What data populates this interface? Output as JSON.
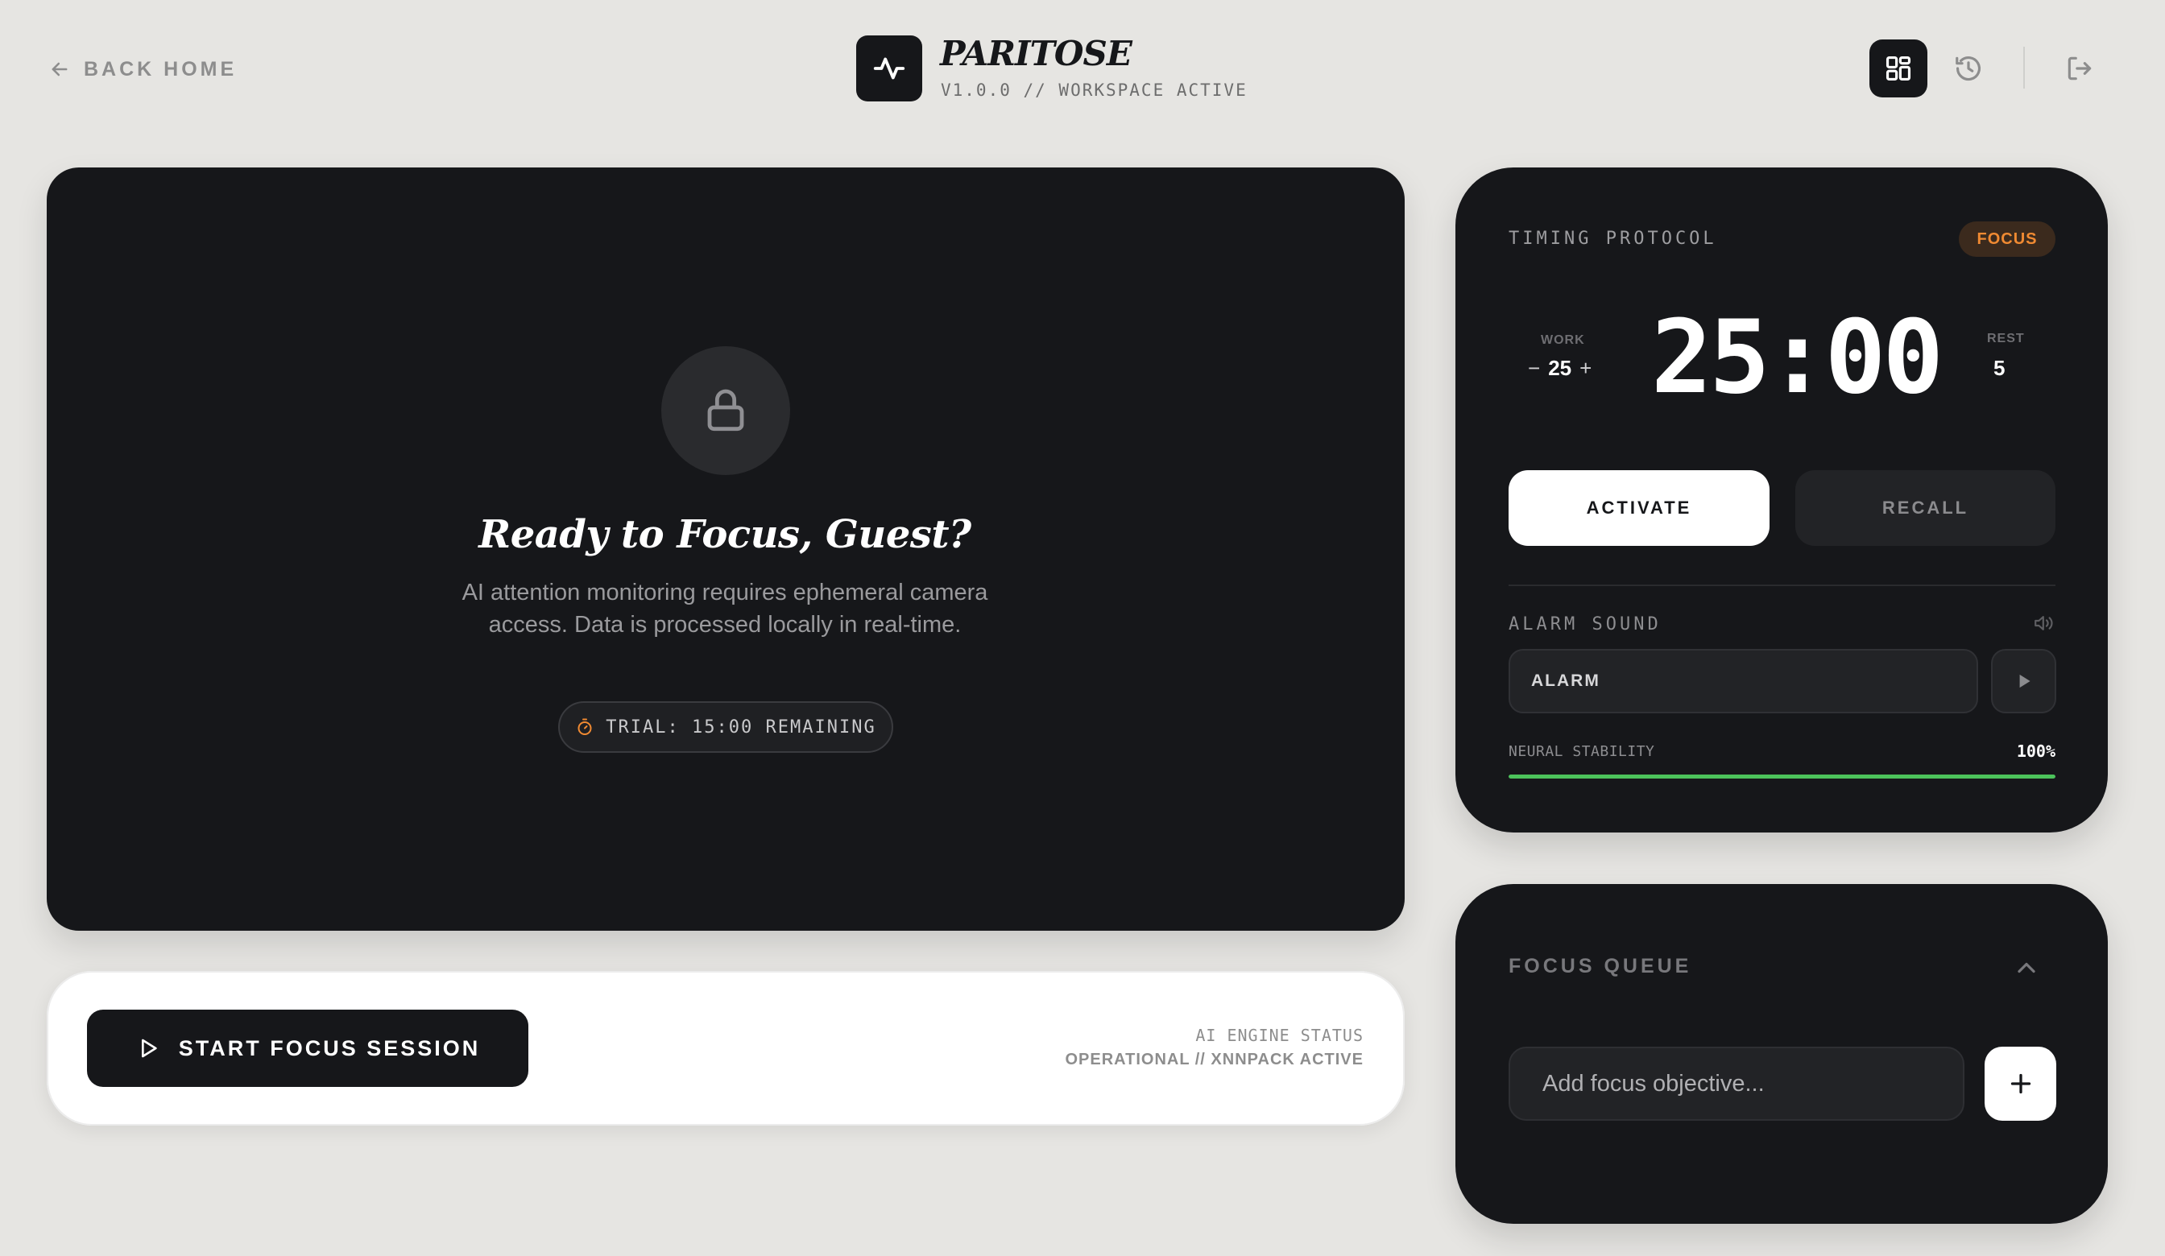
{
  "header": {
    "back_label": "BACK HOME",
    "brand_name": "PARITOSE",
    "brand_subtitle": "V1.0.0 // WORKSPACE ACTIVE",
    "actions": [
      {
        "name": "dashboard-icon",
        "active": true
      },
      {
        "name": "history-icon",
        "active": false
      },
      {
        "name": "logout-icon",
        "active": false
      }
    ]
  },
  "camera": {
    "icon": "lock-icon",
    "title": "Ready to Focus, Guest?",
    "description": "AI attention monitoring requires ephemeral camera access. Data is processed locally in real-time.",
    "trial_icon": "stopwatch-icon",
    "trial_text": "TRIAL: 15:00 REMAINING"
  },
  "session": {
    "start_label": "START FOCUS SESSION",
    "engine_label": "AI ENGINE STATUS",
    "engine_value": "OPERATIONAL // XNNPACK ACTIVE"
  },
  "timing": {
    "label": "TIMING PROTOCOL",
    "mode_badge": "FOCUS",
    "work_label": "WORK",
    "work_decrement": "−",
    "work_value": "25",
    "work_increment": "+",
    "rest_label": "REST",
    "rest_value": "5",
    "timer_display": "25:00",
    "activate_label": "ACTIVATE",
    "recall_label": "RECALL",
    "alarm_label": "ALARM SOUND",
    "alarm_selected": "ALARM",
    "stability_label": "NEURAL STABILITY",
    "stability_value": "100%",
    "stability_fraction": 1.0
  },
  "queue": {
    "title": "FOCUS QUEUE",
    "input_placeholder": "Add focus objective...",
    "input_value": ""
  },
  "colors": {
    "background": "#e6e5e2",
    "panel_dark": "#16171a",
    "accent_orange": "#f08a32",
    "stability_green": "#4cc35b"
  }
}
